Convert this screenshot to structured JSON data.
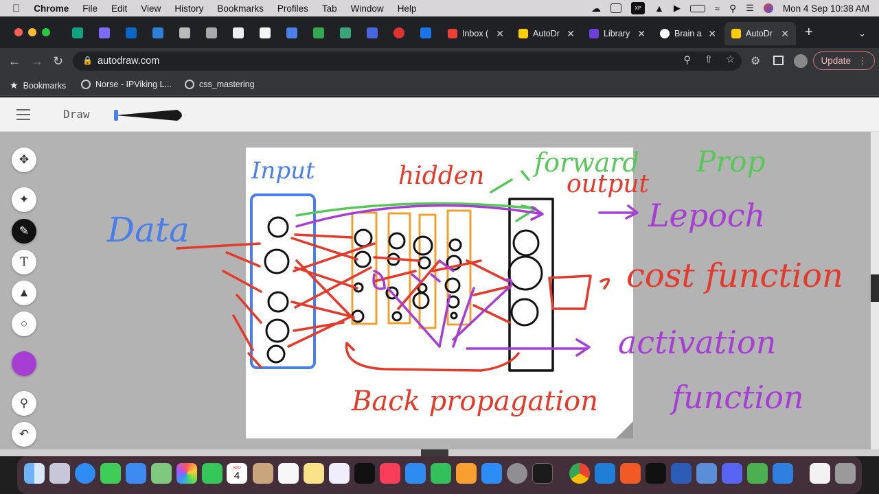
{
  "menubar": {
    "app_name": "Chrome",
    "items": [
      "File",
      "Edit",
      "View",
      "History",
      "Bookmarks",
      "Profiles",
      "Tab",
      "Window",
      "Help"
    ],
    "datetime": "Mon 4 Sep  10:38 AM",
    "xp_pen_label": "XP\npen"
  },
  "tabs": [
    {
      "label": "Inbox (",
      "icon": "gmail-icon",
      "color": "#ea4335"
    },
    {
      "label": "AutoDr",
      "icon": "autodraw-icon",
      "color": "#ffcc00"
    },
    {
      "label": "Library",
      "icon": "library-icon",
      "color": "#6b3fd8"
    },
    {
      "label": "Brain a",
      "icon": "medium-icon",
      "color": "#ffffff"
    },
    {
      "label": "AutoDr",
      "icon": "autodraw-icon",
      "color": "#ffcc00",
      "active": true
    }
  ],
  "address_bar": {
    "url": "autodraw.com"
  },
  "toolbar": {
    "update_label": "Update"
  },
  "bookmarks": [
    {
      "label": "Bookmarks",
      "icon": "star-icon"
    },
    {
      "label": "Norse - IPViking L...",
      "icon": "globe-icon"
    },
    {
      "label": "css_mastering",
      "icon": "globe-icon"
    }
  ],
  "app": {
    "draw_label": "Draw",
    "current_color": "#a63ed3"
  },
  "drawing_text": {
    "input": "Input",
    "hidden": "hidden",
    "forward": "forward",
    "output": "output",
    "prop": "Prop",
    "data": "Data",
    "epoch": "Lepoch",
    "cost_function": "cost function",
    "activation": "activation",
    "function": "function",
    "back_propagation": "Back propagation"
  },
  "colors": {
    "blue": "#4a7ee8",
    "red": "#e23a2b",
    "green": "#58c75a",
    "purple": "#a63ed3",
    "orange": "#f0a030",
    "black": "#111111"
  },
  "dock": {
    "calendar_month": "SEP",
    "calendar_day": "4"
  }
}
